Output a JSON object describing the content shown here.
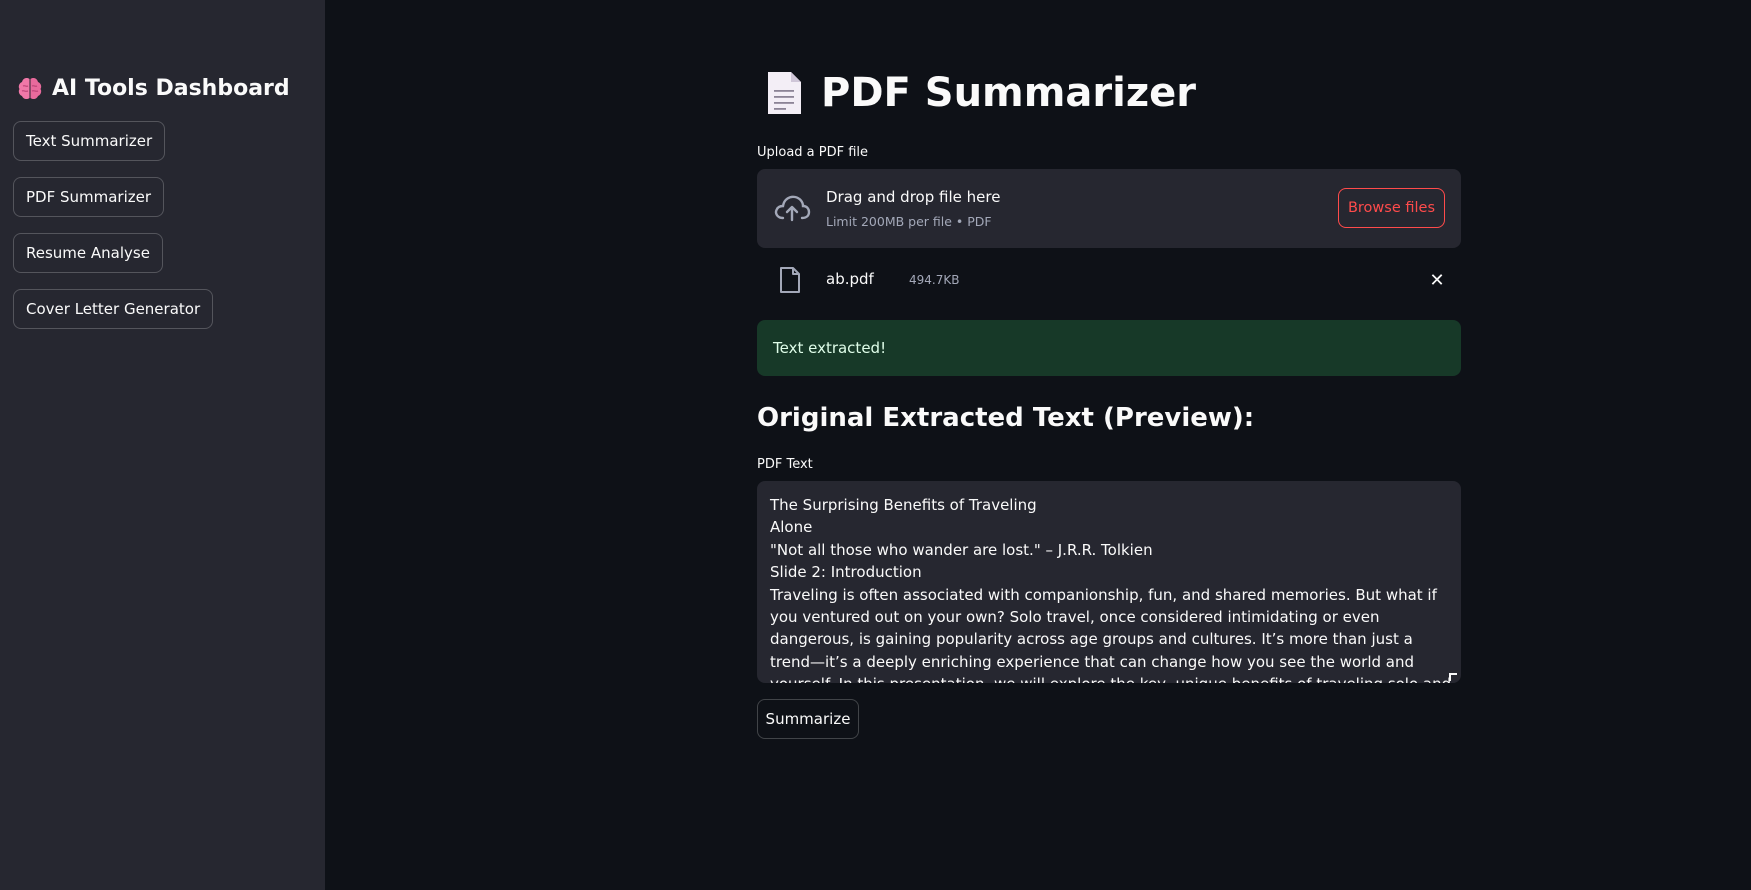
{
  "sidebar": {
    "title": "AI Tools Dashboard",
    "title_icon": "brain-icon",
    "nav": [
      {
        "label": "Text Summarizer"
      },
      {
        "label": "PDF Summarizer"
      },
      {
        "label": "Resume Analyse"
      },
      {
        "label": "Cover Letter Generator"
      }
    ]
  },
  "main": {
    "title": "PDF Summarizer",
    "title_icon": "document-icon",
    "uploader": {
      "label": "Upload a PDF file",
      "drop_title": "Drag and drop file here",
      "drop_sub": "Limit 200MB per file • PDF",
      "browse_label": "Browse files"
    },
    "file": {
      "name": "ab.pdf",
      "size": "494.7KB",
      "remove_label": "✕"
    },
    "success_message": "Text extracted!",
    "preview_heading": "Original Extracted Text (Preview):",
    "textarea_label": "PDF Text",
    "textarea_lines": [
      "The Surprising Benefits of Traveling",
      "Alone",
      "\"Not all those who wander are lost.\" – J.R.R. Tolkien",
      "Slide 2: Introduction",
      "Traveling is often associated with companionship, fun, and shared memories. But what if",
      "you ventured out on your own? Solo travel, once considered intimidating or even",
      "dangerous, is gaining popularity across age groups and cultures. It’s more than just a",
      "trend—it’s a deeply enriching experience that can change how you see the world and",
      "yourself. In this presentation, we will explore the key, unique benefits of traveling solo and"
    ],
    "summarize_label": "Summarize"
  },
  "colors": {
    "background": "#0e1117",
    "sidebar": "#262730",
    "accent": "#ff4b4b",
    "success_bg": "#173928"
  }
}
